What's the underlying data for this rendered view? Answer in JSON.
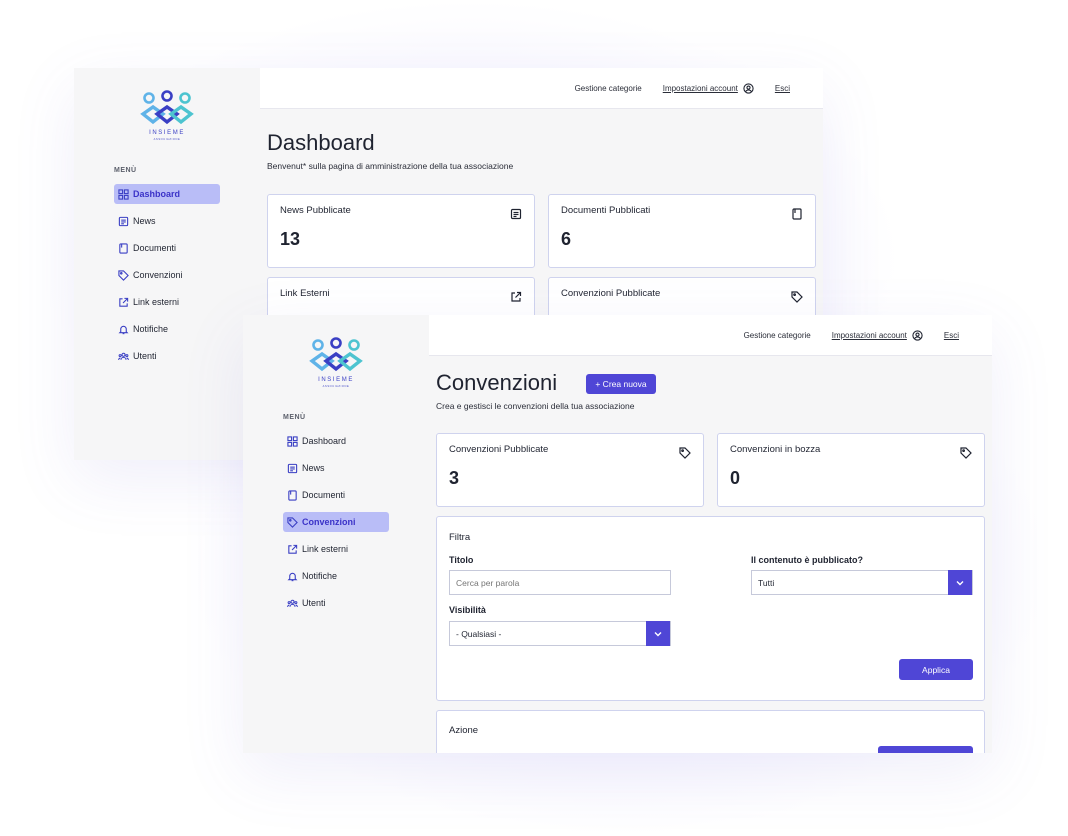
{
  "brand": {
    "logo_text": "INSIEME",
    "logo_subtext": "ASSOCIAZIONE",
    "accent": "#4f46d6"
  },
  "sidebar": {
    "menu_title": "MENÙ",
    "items": [
      {
        "label": "Dashboard",
        "icon": "grid-icon"
      },
      {
        "label": "News",
        "icon": "newspaper-icon"
      },
      {
        "label": "Documenti",
        "icon": "book-icon"
      },
      {
        "label": "Convenzioni",
        "icon": "tag-icon"
      },
      {
        "label": "Link esterni",
        "icon": "external-link-icon"
      },
      {
        "label": "Notifiche",
        "icon": "bell-icon"
      },
      {
        "label": "Utenti",
        "icon": "users-icon"
      }
    ]
  },
  "topbar": {
    "categories": "Gestione categorie",
    "account": "Impostazioni account",
    "logout": "Esci"
  },
  "dashboard": {
    "title": "Dashboard",
    "subtitle": "Benvenut* sulla pagina di amministrazione della tua associazione",
    "cards": [
      {
        "label": "News Pubblicate",
        "value": "13",
        "icon": "newspaper-icon"
      },
      {
        "label": "Documenti Pubblicati",
        "value": "6",
        "icon": "book-icon"
      },
      {
        "label": "Link Esterni",
        "icon": "external-link-icon"
      },
      {
        "label": "Convenzioni Pubblicate",
        "icon": "tag-icon"
      }
    ]
  },
  "convenzioni": {
    "title": "Convenzioni",
    "create_button": "+ Crea nuova",
    "subtitle": "Crea e gestisci le convenzioni della tua associazione",
    "cards": [
      {
        "label": "Convenzioni Pubblicate",
        "value": "3",
        "icon": "tag-icon"
      },
      {
        "label": "Convenzioni in bozza",
        "value": "0",
        "icon": "tag-icon"
      }
    ],
    "filter": {
      "title": "Filtra",
      "titolo_label": "Titolo",
      "titolo_placeholder": "Cerca per parola",
      "published_label": "Il contenuto è pubblicato?",
      "published_value": "Tutti",
      "visibility_label": "Visibilità",
      "visibility_value": "- Qualsiasi -",
      "apply_button": "Applica"
    },
    "action": {
      "title": "Azione"
    }
  }
}
